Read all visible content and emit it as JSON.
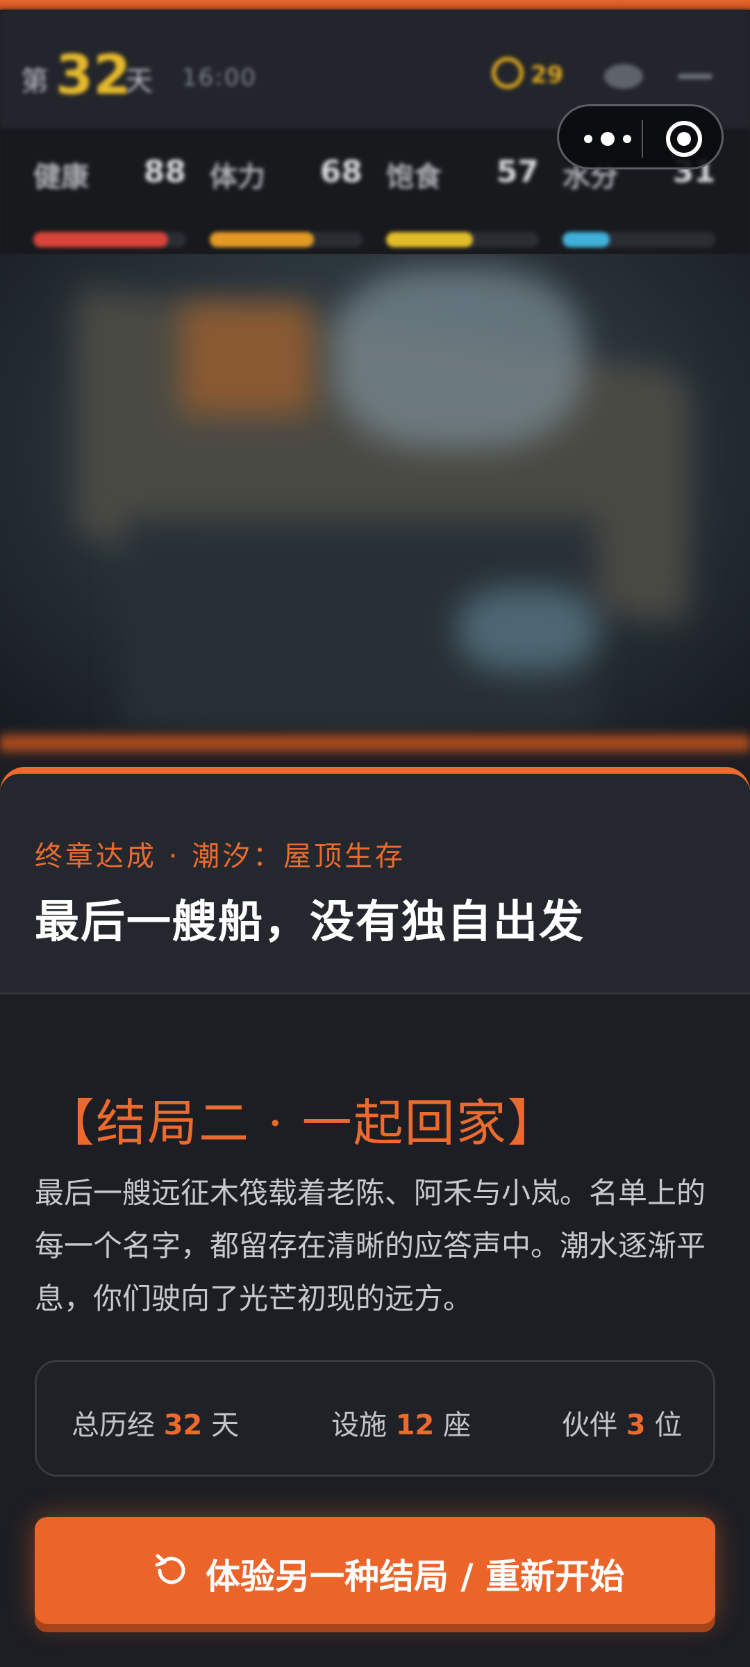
{
  "hud": {
    "day_prefix": "第",
    "day": "32",
    "day_suffix": "天",
    "time": "16:00",
    "coins": "29",
    "stats": [
      {
        "label": "健康",
        "value": "88",
        "level": 0.88,
        "color": "#d8433a"
      },
      {
        "label": "体力",
        "value": "68",
        "level": 0.68,
        "color": "#e39a25"
      },
      {
        "label": "饱食",
        "value": "57",
        "level": 0.57,
        "color": "#e2bd2a"
      },
      {
        "label": "水分",
        "value": "31",
        "level": 0.31,
        "color": "#3fb0d8"
      }
    ]
  },
  "capsule": {
    "more": "more-icon",
    "close": "target-icon"
  },
  "card": {
    "chapter": "终章达成 · 潮汐：屋顶生存",
    "headline": "最后一艘船，没有独自出发",
    "ending_title": "【结局二 · 一起回家】",
    "ending_text": "最后一艘远征木筏载着老陈、阿禾与小岚。名单上的每一个名字，都留存在清晰的应答声中。潮水逐渐平息，你们驶向了光芒初现的远方。",
    "summary": {
      "days_label": "总历经",
      "days": "32",
      "days_unit": "天",
      "facilities_label": "设施",
      "facilities": "12",
      "facilities_unit": "座",
      "partners_label": "伙伴",
      "partners": "3",
      "partners_unit": "位"
    },
    "restart_label": "体验另一种结局 / 重新开始",
    "restart_icon": "restart-icon"
  },
  "colors": {
    "accent": "#eb652a",
    "background": "#1c1e23"
  }
}
